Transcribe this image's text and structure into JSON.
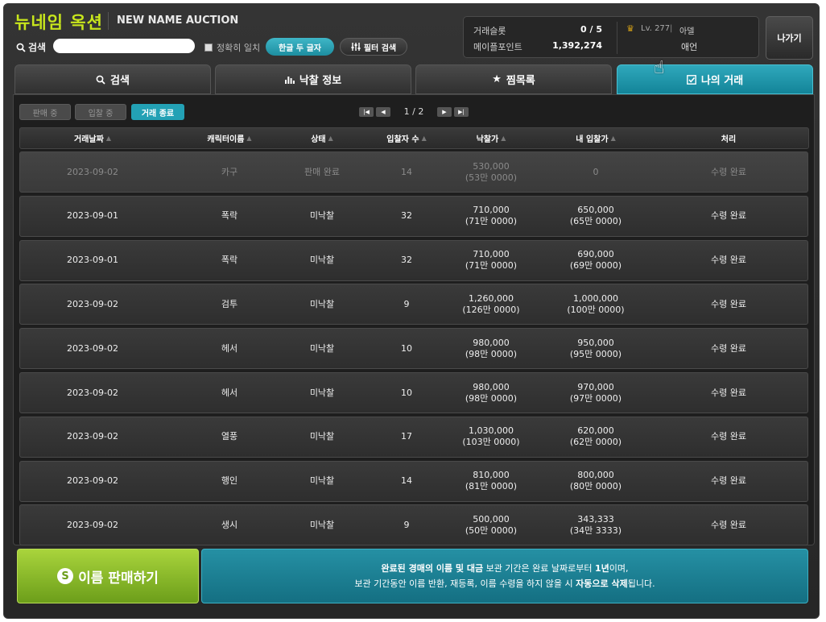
{
  "header": {
    "logo": "뉴네임 옥션",
    "subtitle": "NEW NAME AUCTION",
    "search_label": "검색",
    "search_value": "",
    "exact_match_label": "정확히 일치",
    "hangul_btn": "한글 두 글자",
    "filter_btn": "필터 검색",
    "exit_btn": "나가기"
  },
  "info": {
    "slots_label": "거래슬롯",
    "slots_value": "0 / 5",
    "points_label": "메이플포인트",
    "points_value": "1,392,274",
    "level": "Lv. 277",
    "sep": "|",
    "guild": "아델",
    "character": "애언"
  },
  "tabs": [
    {
      "label": "검색",
      "icon": "search-icon"
    },
    {
      "label": "낙찰 정보",
      "icon": "bar-chart-icon"
    },
    {
      "label": "찜목록",
      "icon": "star-icon"
    },
    {
      "label": "나의 거래",
      "icon": "checkbox-icon"
    }
  ],
  "subtabs": [
    "판매 중",
    "입찰 중",
    "거래 종료"
  ],
  "pager": {
    "info": "1 / 2"
  },
  "columns": [
    "거래날짜",
    "캐릭터이름",
    "상태",
    "입찰자 수",
    "낙찰가",
    "내 입찰가",
    "처리"
  ],
  "rows": [
    {
      "date": "2023-09-02",
      "name": "카구",
      "status": "판매 완료",
      "bidders": "14",
      "price": "530,000",
      "price_sub": "(53만 0000)",
      "mybid": "0",
      "mybid_sub": "",
      "action": "수령 완료",
      "dim": true
    },
    {
      "date": "2023-09-01",
      "name": "폭락",
      "status": "미낙찰",
      "bidders": "32",
      "price": "710,000",
      "price_sub": "(71만 0000)",
      "mybid": "650,000",
      "mybid_sub": "(65만 0000)",
      "action": "수령 완료",
      "dim": false
    },
    {
      "date": "2023-09-01",
      "name": "폭락",
      "status": "미낙찰",
      "bidders": "32",
      "price": "710,000",
      "price_sub": "(71만 0000)",
      "mybid": "690,000",
      "mybid_sub": "(69만 0000)",
      "action": "수령 완료",
      "dim": false
    },
    {
      "date": "2023-09-02",
      "name": "검투",
      "status": "미낙찰",
      "bidders": "9",
      "price": "1,260,000",
      "price_sub": "(126만 0000)",
      "mybid": "1,000,000",
      "mybid_sub": "(100만 0000)",
      "action": "수령 완료",
      "dim": false
    },
    {
      "date": "2023-09-02",
      "name": "헤서",
      "status": "미낙찰",
      "bidders": "10",
      "price": "980,000",
      "price_sub": "(98만 0000)",
      "mybid": "950,000",
      "mybid_sub": "(95만 0000)",
      "action": "수령 완료",
      "dim": false
    },
    {
      "date": "2023-09-02",
      "name": "헤서",
      "status": "미낙찰",
      "bidders": "10",
      "price": "980,000",
      "price_sub": "(98만 0000)",
      "mybid": "970,000",
      "mybid_sub": "(97만 0000)",
      "action": "수령 완료",
      "dim": false
    },
    {
      "date": "2023-09-02",
      "name": "열풍",
      "status": "미낙찰",
      "bidders": "17",
      "price": "1,030,000",
      "price_sub": "(103만 0000)",
      "mybid": "620,000",
      "mybid_sub": "(62만 0000)",
      "action": "수령 완료",
      "dim": false
    },
    {
      "date": "2023-09-02",
      "name": "행인",
      "status": "미낙찰",
      "bidders": "14",
      "price": "810,000",
      "price_sub": "(81만 0000)",
      "mybid": "800,000",
      "mybid_sub": "(80만 0000)",
      "action": "수령 완료",
      "dim": false
    },
    {
      "date": "2023-09-02",
      "name": "생시",
      "status": "미낙찰",
      "bidders": "9",
      "price": "500,000",
      "price_sub": "(50만 0000)",
      "mybid": "343,333",
      "mybid_sub": "(34만 3333)",
      "action": "수령 완료",
      "dim": false
    }
  ],
  "footer": {
    "sell_btn": "이름 판매하기",
    "notice_1a": "완료된 경매의 이름 및 대금",
    "notice_1b": " 보관 기간은 완료 날짜로부터 ",
    "notice_1c": "1년",
    "notice_1d": "이며,",
    "notice_2a": "보관 기간동안 이름 반환, 재등록, 이름 수령을 하지 않을 시 ",
    "notice_2b": "자동으로 삭제",
    "notice_2c": "됩니다."
  }
}
